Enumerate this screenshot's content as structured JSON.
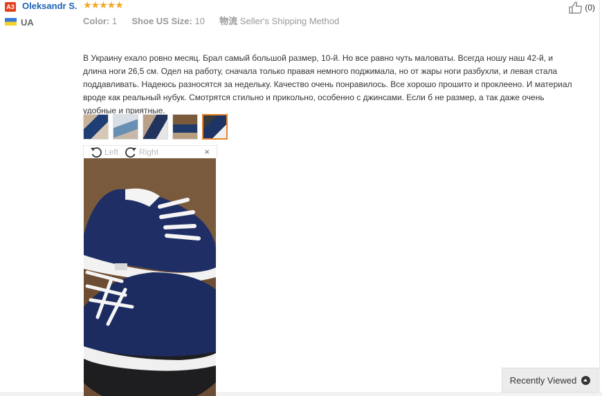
{
  "review": {
    "user": {
      "level_badge": "A3",
      "name": "Oleksandr S.",
      "country": "UA",
      "rating_stars": "★★★★★"
    },
    "meta": {
      "color_label": "Color:",
      "color_value": "1",
      "size_label": "Shoe US Size:",
      "size_value": "10",
      "shipping_label": "物流",
      "shipping_value": "Seller's Shipping Method"
    },
    "helpful_count": "(0)",
    "text": "В Украину ехало ровно месяц. Брал самый большой размер, 10-й. Но все равно чуть маловаты. Всегда ношу наш 42-й, и длина ноги 26,5 см. Одел на работу, сначала только правая немного поджимала, но от жары ноги разбухли, и левая стала поддавливать. Надеюсь разносятся за недельку. Качество очень понравилось. Все хорошо прошито и проклеено. И материал вроде как реальный нубук. Смотрятся стильно и прикольно, особенно с джинсами. Если б не размер, а так даже очень удобные и приятные.",
    "photo_count": 5,
    "active_photo_index": 5,
    "viewer": {
      "rotate_left_label": "Left",
      "rotate_right_label": "Right",
      "close_label": "×"
    }
  },
  "recently_viewed": {
    "label": "Recently Viewed"
  },
  "colors": {
    "badge": "#e0401c",
    "username": "#1e62b8",
    "stars": "#f5a623",
    "active_thumb_border": "#e8852b"
  },
  "icons": [
    "thumbs-up-icon",
    "rotate-left-icon",
    "rotate-right-icon",
    "close-icon",
    "chevron-up-icon",
    "flag-icon"
  ]
}
